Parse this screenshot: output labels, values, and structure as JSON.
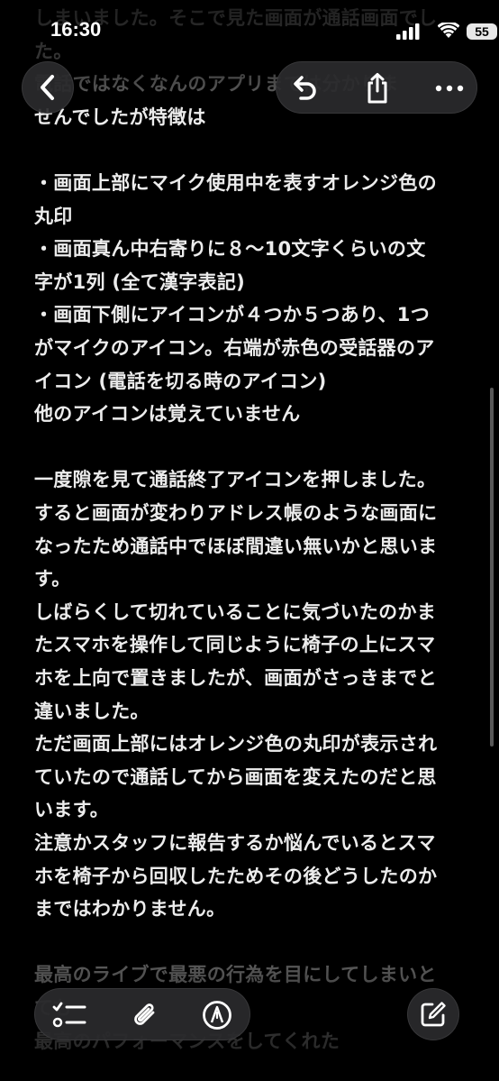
{
  "status_bar": {
    "time": "16:30",
    "battery": "55"
  },
  "note": {
    "lines": [
      "しまいました。そこで見た画面が通話画面でし",
      "た。",
      "電話ではなくなんのアプリまでは分かりま",
      "せんでしたが特徴は",
      "",
      "・画面上部にマイク使用中を表すオレンジ色の",
      "丸印",
      "・画面真ん中右寄りに８〜10文字くらいの文",
      "字が1列 (全て漢字表記)",
      "・画面下側にアイコンが４つか５つあり、1つ",
      "がマイクのアイコン。右端が赤色の受話器のア",
      "イコン (電話を切る時のアイコン)",
      "他のアイコンは覚えていません",
      "",
      "一度隙を見て通話終了アイコンを押しました。",
      "すると画面が変わりアドレス帳のような画面に",
      "なったため通話中でほぼ間違い無いかと思いま",
      "す。",
      "しばらくして切れていることに気づいたのかま",
      "たスマホを操作して同じように椅子の上にスマ",
      "ホを上向で置きましたが、画面がさっきまでと",
      "違いました。",
      "ただ画面上部にはオレンジ色の丸印が表示され",
      "ていたので通話してから画面を変えたのだと思",
      "います。",
      "注意かスタッフに報告するか悩んでいるとスマ",
      "ホを椅子から回収したためその後どうしたのか",
      "まではわかりません。",
      "",
      "最高のライブで最悪の行為を目にしてしまいと",
      "ても",
      "最高のパフォーマンスをしてくれた"
    ]
  }
}
